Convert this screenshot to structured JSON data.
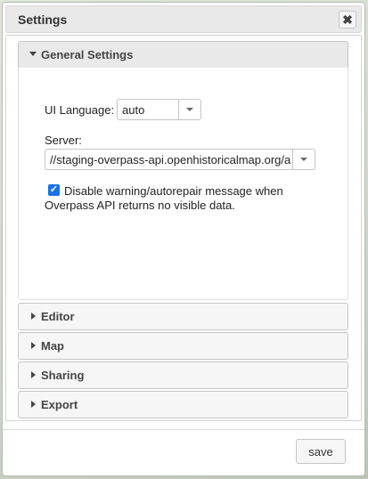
{
  "dialog": {
    "title": "Settings",
    "close_icon": "close-icon"
  },
  "sections": {
    "general": {
      "label": "General Settings",
      "expanded": true
    },
    "editor": {
      "label": "Editor"
    },
    "map": {
      "label": "Map"
    },
    "sharing": {
      "label": "Sharing"
    },
    "export": {
      "label": "Export"
    }
  },
  "general": {
    "ui_language_label": "UI Language:",
    "ui_language_value": "auto",
    "server_label": "Server:",
    "server_value": "//staging-overpass-api.openhistoricalmap.org/a",
    "disable_warning_checked": true,
    "disable_warning_label": "Disable warning/autorepair message when Overpass API returns no visible data."
  },
  "footer": {
    "save_label": "save"
  }
}
